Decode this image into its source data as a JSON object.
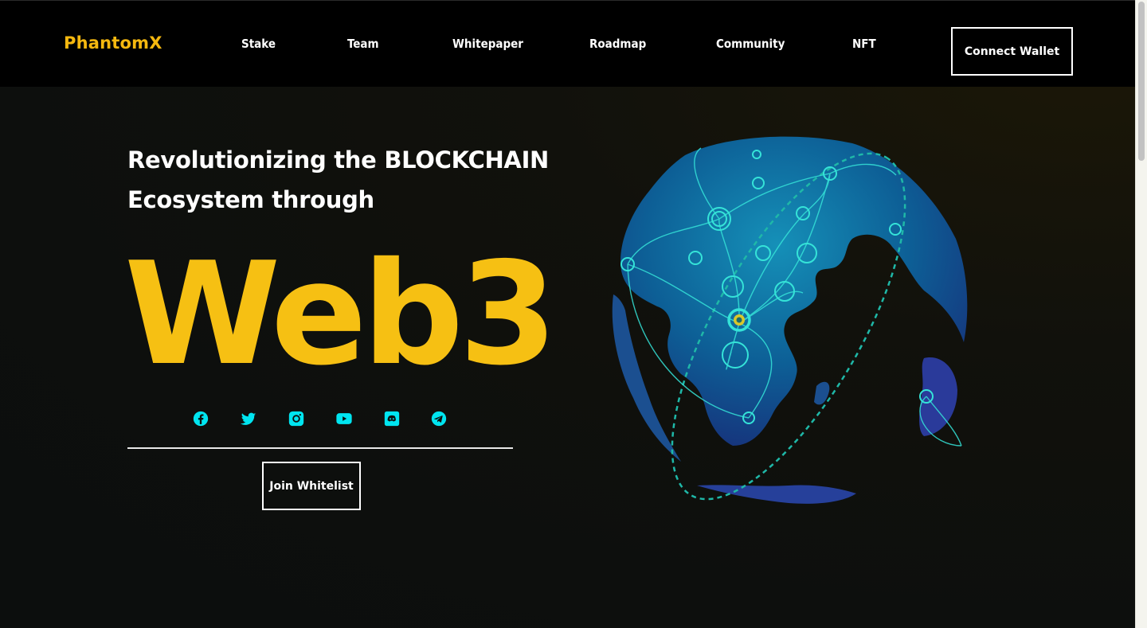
{
  "header": {
    "logo": "PhantomX",
    "nav": [
      "Stake",
      "Team",
      "Whitepaper",
      "Roadmap",
      "Community",
      "NFT"
    ],
    "connect_label": "Connect Wallet"
  },
  "hero": {
    "title_line1": "Revolutionizing the BLOCKCHAIN",
    "title_line2": "Ecosystem through",
    "big_text": "Web3",
    "socials": [
      "facebook-icon",
      "twitter-icon",
      "instagram-icon",
      "youtube-icon",
      "discord-icon",
      "telegram-icon"
    ],
    "join_label": "Join Whitelist"
  },
  "colors": {
    "accent": "#f6c013",
    "social": "#00e5f0",
    "header_bg": "#000000",
    "page_bg": "#0d0f0d"
  }
}
